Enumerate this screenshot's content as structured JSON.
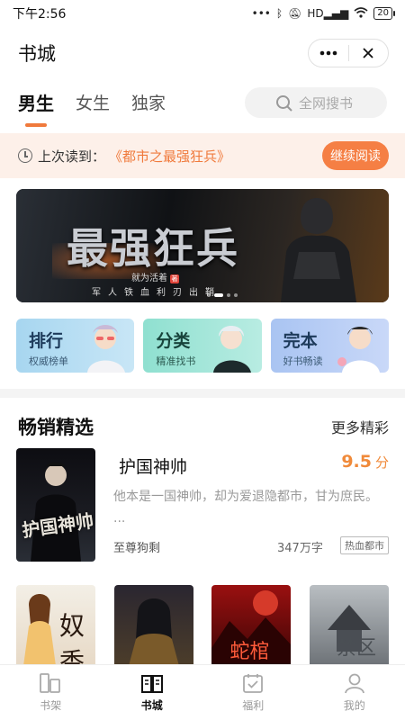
{
  "status": {
    "time": "下午2:56",
    "battery": "20",
    "signal_text": "HD"
  },
  "header": {
    "title": "书城",
    "more_icon": "more-dots-icon",
    "close_icon": "close-icon"
  },
  "tabs": [
    {
      "label": "男生",
      "active": true
    },
    {
      "label": "女生",
      "active": false
    },
    {
      "label": "独家",
      "active": false
    }
  ],
  "search": {
    "placeholder": "全网搜书"
  },
  "last_read": {
    "prefix": "上次读到：",
    "book": "《都市之最强狂兵》",
    "button": "继续阅读"
  },
  "banner": {
    "title": "最强狂兵",
    "author": "就为活着",
    "badge": "著",
    "slogan": "军人铁血利刃出鞘",
    "active_slide": 1,
    "slide_count": 4
  },
  "categories": [
    {
      "title": "排行",
      "subtitle": "权威榜单"
    },
    {
      "title": "分类",
      "subtitle": "精准找书"
    },
    {
      "title": "完本",
      "subtitle": "好书畅读"
    }
  ],
  "section": {
    "title": "畅销精选",
    "more": "更多精彩"
  },
  "featured": {
    "title": "护国神帅",
    "score": "9.5",
    "score_unit": "分",
    "description": "他本是一国神帅，却为爱退隐都市，甘为庶民。 ...",
    "author": "至尊狗剩",
    "words": "347万字",
    "tag": "热血都市",
    "cover_text": "护国神帅"
  },
  "grid_books": [
    {
      "cover_text": "奴香"
    },
    {
      "cover_text": ""
    },
    {
      "cover_text": "蛇棺"
    },
    {
      "cover_text": "禁区"
    }
  ],
  "bottom_nav": [
    {
      "label": "书架",
      "icon": "bookshelf-icon",
      "active": false
    },
    {
      "label": "书城",
      "icon": "book-open-icon",
      "active": true
    },
    {
      "label": "福利",
      "icon": "calendar-check-icon",
      "active": false
    },
    {
      "label": "我的",
      "icon": "user-icon",
      "active": false
    }
  ],
  "colors": {
    "accent": "#f57f44",
    "score": "#f08a3a",
    "last_read_bg": "#fdf0e9"
  }
}
